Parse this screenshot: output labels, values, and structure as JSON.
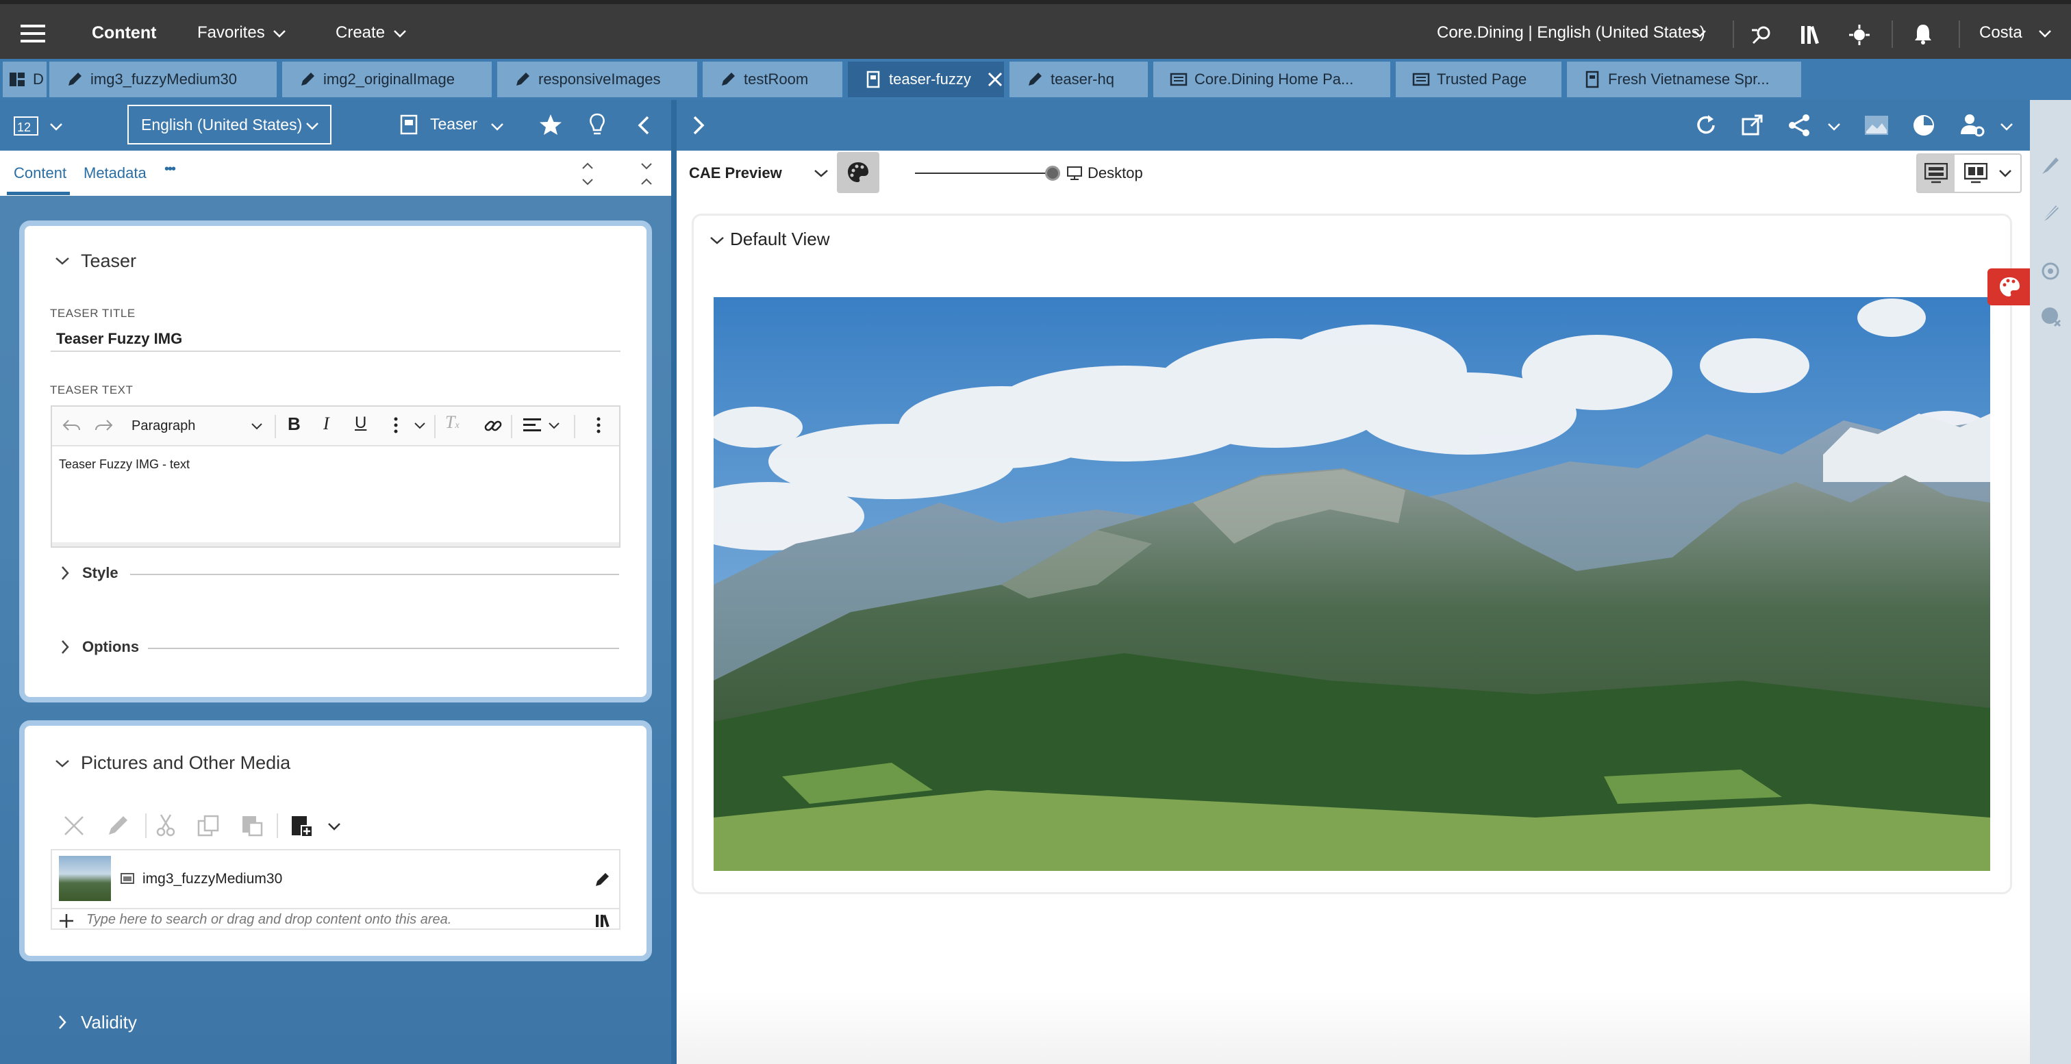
{
  "topbar": {
    "content_label": "Content",
    "favorites_label": "Favorites",
    "create_label": "Create",
    "site_selector": "Core.Dining | English (United States)",
    "user_label": "Costa"
  },
  "tabs": [
    {
      "label": "D"
    },
    {
      "label": "img3_fuzzyMedium30"
    },
    {
      "label": "img2_originalImage"
    },
    {
      "label": "responsiveImages"
    },
    {
      "label": "testRoom"
    },
    {
      "label": "teaser-fuzzy"
    },
    {
      "label": "teaser-hq"
    },
    {
      "label": "Core.Dining Home Pa..."
    },
    {
      "label": "Trusted Page"
    },
    {
      "label": "Fresh Vietnamese Spr..."
    }
  ],
  "left_toolbar": {
    "locale_select": "English (United States)",
    "doctype_label": "Teaser"
  },
  "subtabs": {
    "content": "Content",
    "metadata": "Metadata",
    "more": "•••"
  },
  "teaser_section": {
    "title": "Teaser",
    "title_label": "TEASER TITLE",
    "title_value": "Teaser Fuzzy IMG",
    "text_label": "TEASER TEXT",
    "paragraph_select": "Paragraph",
    "text_value": "Teaser Fuzzy IMG - text",
    "style_label": "Style",
    "options_label": "Options"
  },
  "media_section": {
    "title": "Pictures and Other Media",
    "item_name": "img3_fuzzyMedium30",
    "search_placeholder": "Type here to search or drag and drop content onto this area."
  },
  "validity_label": "Validity",
  "preview": {
    "source_label": "CAE Preview",
    "device_label": "Desktop",
    "default_view_label": "Default View"
  },
  "colors": {
    "topbar": "#3b3b3b",
    "tab_active": "#2e6596",
    "tab_inactive": "#79a6cc",
    "accent_red": "#d9342b",
    "link_blue": "#2b6ea3"
  }
}
